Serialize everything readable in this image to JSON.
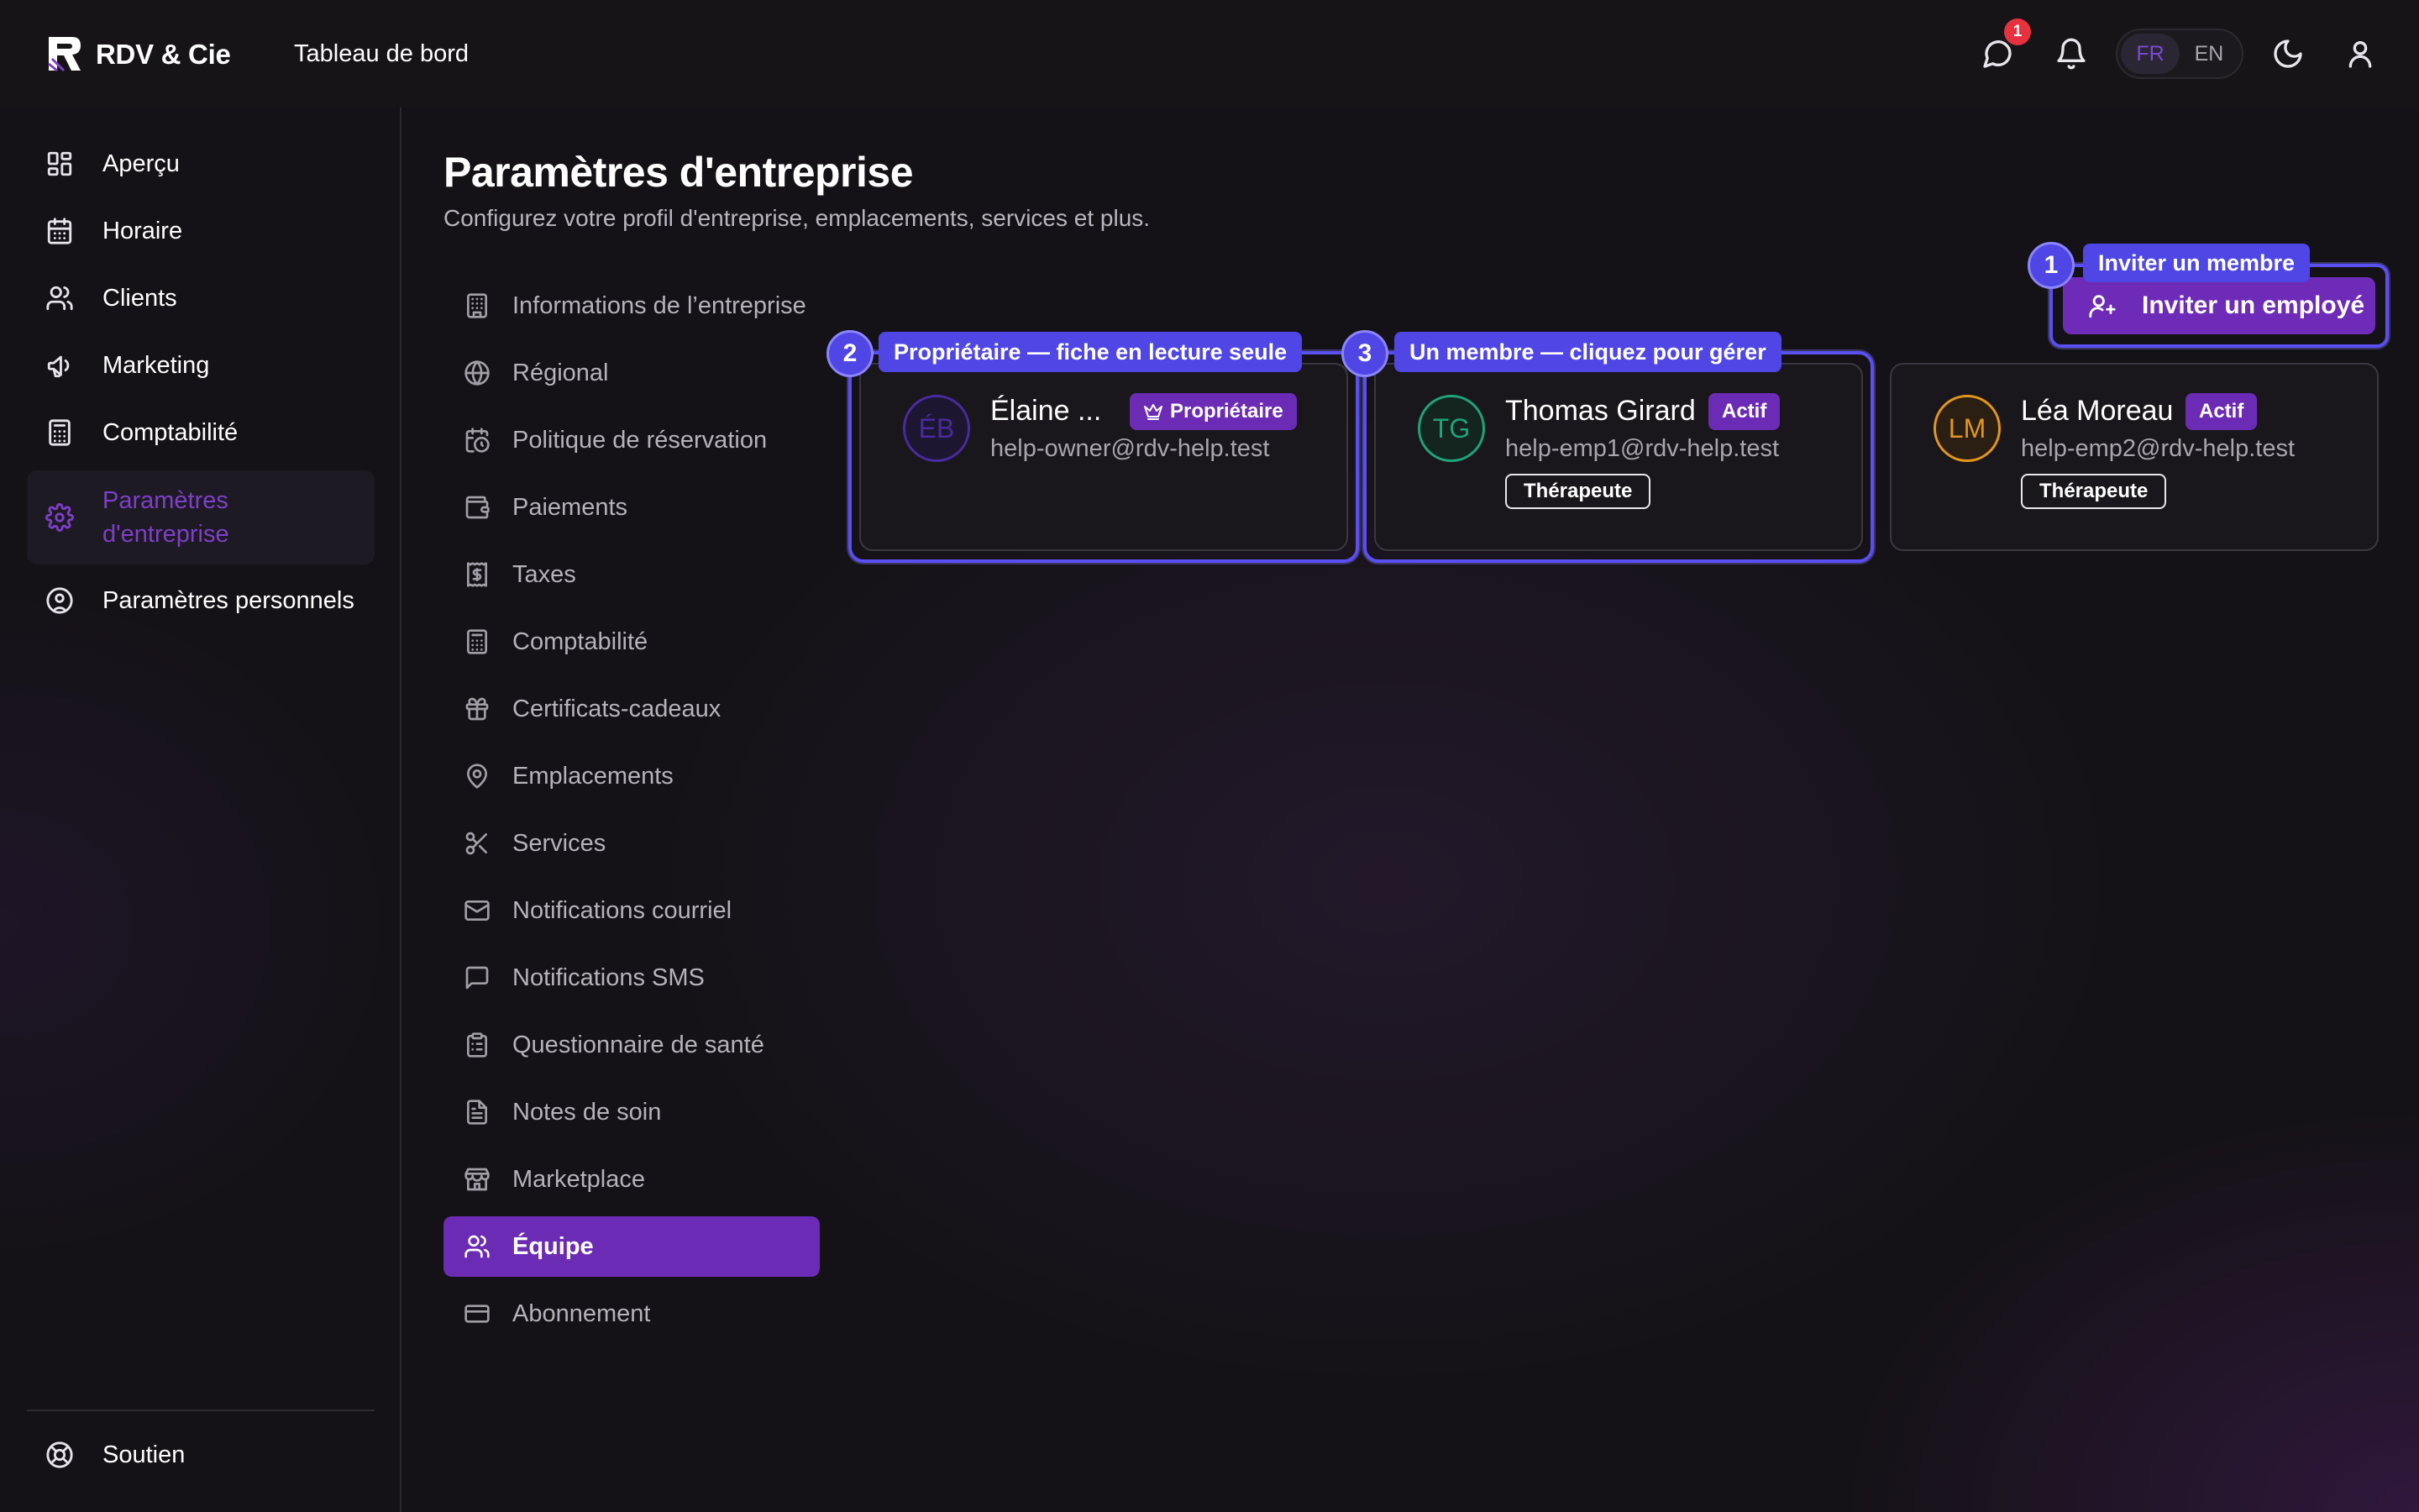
{
  "app": {
    "brand": "RDV & Cie",
    "page_tab": "Tableau de bord",
    "notification_count": "1",
    "languages": [
      "FR",
      "EN"
    ],
    "active_language": "FR"
  },
  "sidebar": {
    "items": [
      {
        "label": "Aperçu",
        "icon": "grid-icon"
      },
      {
        "label": "Horaire",
        "icon": "calendar-icon"
      },
      {
        "label": "Clients",
        "icon": "users-icon"
      },
      {
        "label": "Marketing",
        "icon": "megaphone-icon"
      },
      {
        "label": "Comptabilité",
        "icon": "calculator-icon"
      },
      {
        "label": "Paramètres\nd'entreprise",
        "icon": "gear-icon",
        "active": true
      },
      {
        "label": "Paramètres personnels",
        "icon": "user-circle-icon"
      }
    ],
    "footer": {
      "label": "Soutien",
      "icon": "lifebuoy-icon"
    }
  },
  "main": {
    "title": "Paramètres d'entreprise",
    "subtitle": "Configurez votre profil d'entreprise, emplacements, services et plus.",
    "settings_nav": [
      {
        "label": "Informations de l’entreprise",
        "icon": "building-icon"
      },
      {
        "label": "Régional",
        "icon": "globe-icon"
      },
      {
        "label": "Politique de réservation",
        "icon": "calendar-clock-icon"
      },
      {
        "label": "Paiements",
        "icon": "wallet-icon"
      },
      {
        "label": "Taxes",
        "icon": "receipt-dollar-icon"
      },
      {
        "label": "Comptabilité",
        "icon": "calculator-icon"
      },
      {
        "label": "Certificats-cadeaux",
        "icon": "gift-icon"
      },
      {
        "label": "Emplacements",
        "icon": "map-pin-icon"
      },
      {
        "label": "Services",
        "icon": "scissors-icon"
      },
      {
        "label": "Notifications courriel",
        "icon": "mail-icon"
      },
      {
        "label": "Notifications SMS",
        "icon": "message-square-icon"
      },
      {
        "label": "Questionnaire de santé",
        "icon": "clipboard-icon"
      },
      {
        "label": "Notes de soin",
        "icon": "file-text-icon"
      },
      {
        "label": "Marketplace",
        "icon": "store-icon"
      },
      {
        "label": "Équipe",
        "icon": "users-icon",
        "active": true
      },
      {
        "label": "Abonnement",
        "icon": "credit-card-icon"
      }
    ],
    "invite_button": "Inviter un employé",
    "members": [
      {
        "initials": "ÉB",
        "name": "Élaine ...",
        "email": "help-owner@rdv-help.test",
        "badge": "Propriétaire",
        "role": "",
        "color": "#4a2aa0"
      },
      {
        "initials": "TG",
        "name": "Thomas Girard",
        "email": "help-emp1@rdv-help.test",
        "badge": "Actif",
        "role": "Thérapeute",
        "color": "#1ea37a"
      },
      {
        "initials": "LM",
        "name": "Léa Moreau",
        "email": "help-emp2@rdv-help.test",
        "badge": "Actif",
        "role": "Thérapeute",
        "color": "#e3961b"
      }
    ]
  },
  "callouts": [
    {
      "num": "1",
      "label": "Inviter un membre"
    },
    {
      "num": "2",
      "label": "Propriétaire — fiche en lecture seule"
    },
    {
      "num": "3",
      "label": "Un membre — cliquez pour gérer"
    }
  ],
  "colors": {
    "accent": "#6b2bb5",
    "callout": "#4f46e5",
    "background": "#141216"
  }
}
